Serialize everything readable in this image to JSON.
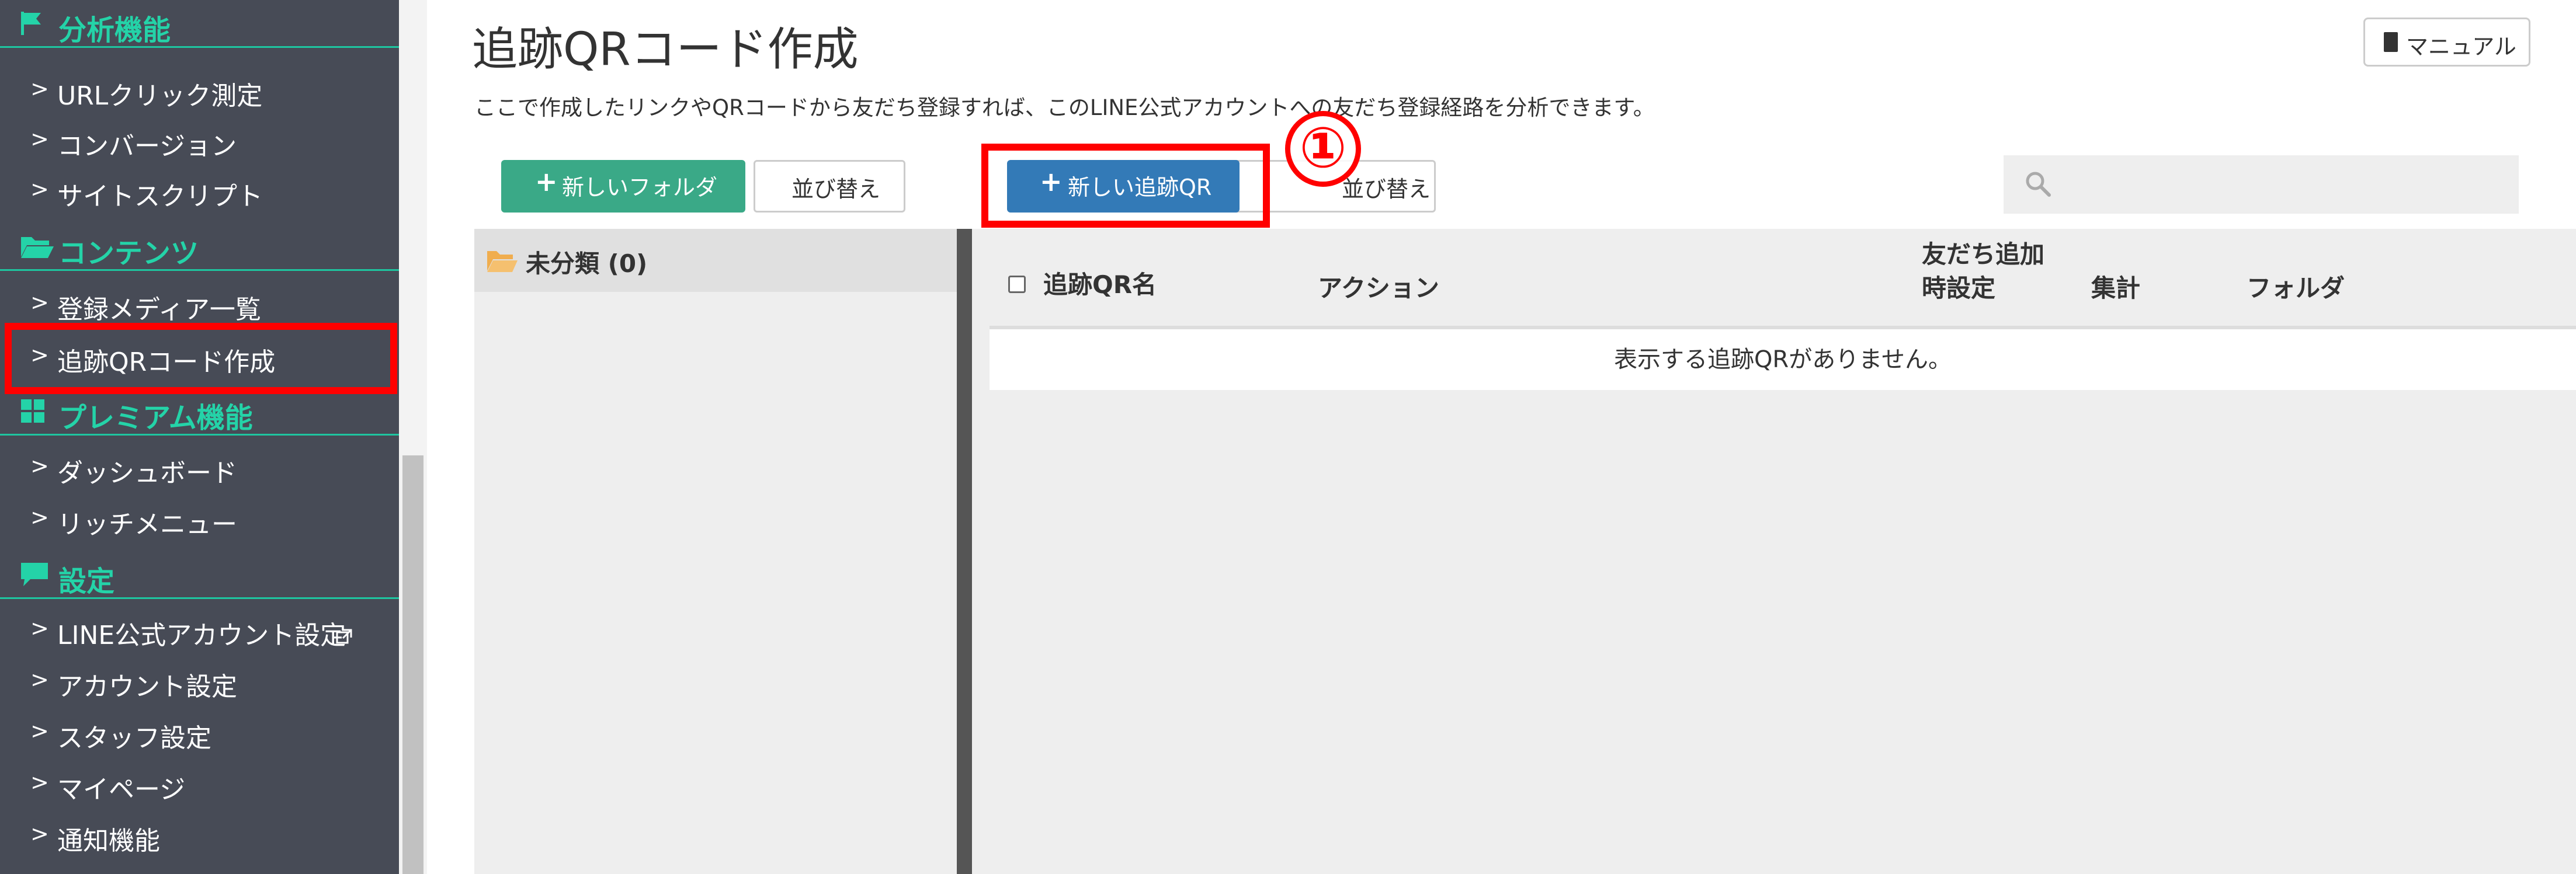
{
  "sidebar": {
    "sections": [
      {
        "label": "分析機能",
        "icon": "flag-icon"
      },
      {
        "label": "コンテンツ",
        "icon": "folder-open-icon"
      },
      {
        "label": "プレミアム機能",
        "icon": "grid-icon"
      },
      {
        "label": "設定",
        "icon": "comment-icon"
      }
    ],
    "items": [
      {
        "label": "URLクリック測定"
      },
      {
        "label": "コンバージョン"
      },
      {
        "label": "サイトスクリプト"
      },
      {
        "label": "登録メディア一覧"
      },
      {
        "label": "追跡QRコード作成"
      },
      {
        "label": "ダッシュボード"
      },
      {
        "label": "リッチメニュー"
      },
      {
        "label": "LINE公式アカウント設定"
      },
      {
        "label": "アカウント設定"
      },
      {
        "label": "スタッフ設定"
      },
      {
        "label": "マイページ"
      },
      {
        "label": "通知機能"
      }
    ],
    "chevron": ">",
    "external_icon": "external-link-icon"
  },
  "header": {
    "title": "追跡QRコード作成",
    "description": "ここで作成したリンクやQRコードから友だち登録すれば、このLINE公式アカウントへの友だち登録経路を分析できます。",
    "manual_label": "マニュアル",
    "manual_icon": "book-icon"
  },
  "toolbar": {
    "new_folder_label": "新しいフォルダ",
    "sort_left_label": "並び替え",
    "new_qr_label": "新しい追跡QR",
    "sort_right_label": "並び替え",
    "plus": "+",
    "search_placeholder": ""
  },
  "annotation": {
    "step_marker": "①"
  },
  "folders": [
    {
      "label": "未分類 (0)"
    }
  ],
  "table": {
    "columns": {
      "name": "追跡QR名",
      "action": "アクション",
      "setting_line1": "友だち追加",
      "setting_line2": "時設定",
      "aggregate": "集計",
      "folder": "フォルダ"
    },
    "empty_message": "表示する追跡QRがありません。"
  },
  "colors": {
    "sidebar_bg": "#474b56",
    "accent_green": "#24d3a8",
    "button_green": "#3aa987",
    "button_blue": "#337ab7",
    "highlight_red": "#ff0000"
  }
}
